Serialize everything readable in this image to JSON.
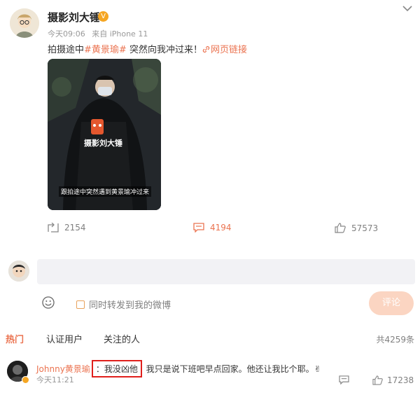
{
  "post": {
    "username": "摄影刘大锤",
    "badge_icon": "verified-badge-icon",
    "time": "今天09:06",
    "source": "来自 iPhone 11",
    "text_prefix": "拍摄途中",
    "hashtag": "#黄景瑜#",
    "text_suffix": " 突然向我冲过来！",
    "link_label": "网页链接",
    "video_overlay": {
      "logo_text": "摄影刘大锤",
      "caption": "跟拍途中突然遇到黄景瑜冲过来"
    }
  },
  "actions": {
    "repost_count": "2154",
    "comment_count": "4194",
    "like_count": "57573"
  },
  "composer": {
    "input_value": "",
    "forward_label": "同时转发到我的微博",
    "submit_label": "评论"
  },
  "tabs": {
    "items": [
      "热门",
      "认证用户",
      "关注的人"
    ],
    "total": "共4259条"
  },
  "comment": {
    "user": "Johnny黄景瑜",
    "highlight": "：我没凶他",
    "text": "我只是说下班吧早点回家。他还让我比个耶。✌",
    "time": "今天11:21",
    "likes": "17238"
  },
  "colors": {
    "accent": "#eb7350",
    "highlight_border": "#e0201c",
    "submit_bg": "#fbd5c2"
  }
}
